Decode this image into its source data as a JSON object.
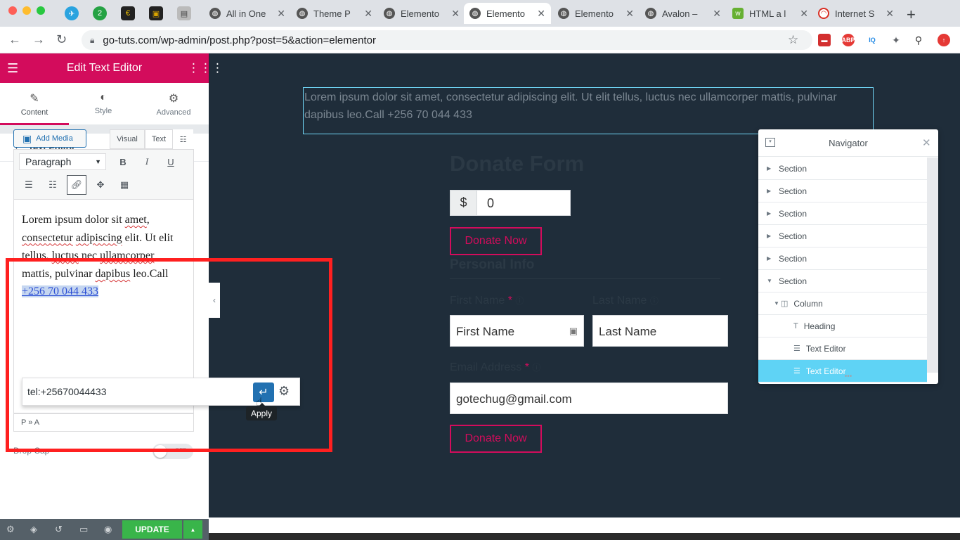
{
  "browser": {
    "tabs": [
      {
        "title": "All in One"
      },
      {
        "title": "Theme P"
      },
      {
        "title": "Elemento"
      },
      {
        "title": "Elemento"
      },
      {
        "title": "Elemento"
      },
      {
        "title": "Avalon –"
      },
      {
        "title": "HTML a l"
      },
      {
        "title": "Internet S"
      }
    ],
    "url": "go-tuts.com/wp-admin/post.php?post=5&action=elementor",
    "pinned_badge": "2"
  },
  "panel": {
    "header_title": "Edit Text Editor",
    "tabs": [
      {
        "label": "Content",
        "icon": "pencil-icon"
      },
      {
        "label": "Style",
        "icon": "half-circle-icon"
      },
      {
        "label": "Advanced",
        "icon": "gear-icon"
      }
    ],
    "section_title": "Text Editor",
    "add_media_label": "Add Media",
    "editor_tabs": [
      "Visual",
      "Text"
    ],
    "format_select": "Paragraph",
    "toolbar": {
      "bold": "B",
      "italic": "I",
      "underline": "U"
    },
    "editor_text": {
      "w1": "Lorem ipsum dolor sit",
      "w2": "amet",
      "w3": "consectetur",
      "w4": "adipiscing",
      "w5": "elit. Ut elit tellus,",
      "w6": "luctus",
      "w7": "nec",
      "w8": "ullamcorper",
      "w9": "mattis, pulvinar",
      "w10": "dapibus",
      "w11": "leo.Call",
      "link": "+256 70 044 433"
    },
    "status_path": "P » A",
    "drop_cap_label": "Drop Cap",
    "drop_cap_state": "OFF",
    "update_label": "UPDATE"
  },
  "link_popup": {
    "value": "tel:+25670044433",
    "tooltip": "Apply"
  },
  "canvas": {
    "text_widget": "Lorem ipsum dolor sit amet, consectetur adipiscing elit. Ut elit tellus, luctus nec ullamcorper mattis, pulvinar dapibus leo.Call +256 70 044 433",
    "donate_title": "Donate Form",
    "currency": "$",
    "amount": "0",
    "donate_button": "Donate Now",
    "personal_info": "Personal Info",
    "first_name_label": "First Name",
    "last_name_label": "Last Name",
    "required_mark": "*",
    "first_name_placeholder": "First Name",
    "last_name_placeholder": "Last Name",
    "email_label": "Email Address",
    "email_value": "gotechug@gmail.com",
    "donate_button_2": "Donate Now"
  },
  "navigator": {
    "title": "Navigator",
    "items": [
      {
        "label": "Section"
      },
      {
        "label": "Section"
      },
      {
        "label": "Section"
      },
      {
        "label": "Section"
      },
      {
        "label": "Section"
      },
      {
        "label": "Section"
      },
      {
        "label": "Column"
      },
      {
        "label": "Heading"
      },
      {
        "label": "Text Editor"
      },
      {
        "label": "Text Editor"
      }
    ]
  },
  "colors": {
    "elementor_pink": "#d30c5c",
    "canvas_bg": "#1f2d3a",
    "update_green": "#39b54a",
    "navigator_selected": "#5fd3f5",
    "highlight_red": "#ff2020"
  }
}
